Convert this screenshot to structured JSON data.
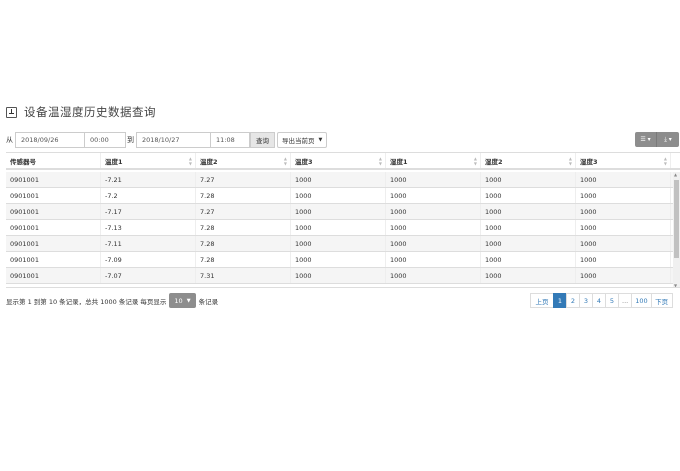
{
  "title": "设备温湿度历史数据查询",
  "filter": {
    "from_label": "从",
    "from_date": "2018/09/26",
    "from_time": "00:00",
    "to_label": "到",
    "to_date": "2018/10/27",
    "to_time": "11:08",
    "query_button": "查询",
    "export_select": "导出当前页"
  },
  "toolbar": {
    "columns_icon": "list-icon",
    "export_icon": "download-icon"
  },
  "table": {
    "headers": [
      "传感器号",
      "温度1",
      "温度2",
      "温度3",
      "湿度1",
      "湿度2",
      "湿度3"
    ],
    "rows": [
      [
        "0901001",
        "-7.21",
        "7.27",
        "1000",
        "1000",
        "1000",
        "1000"
      ],
      [
        "0901001",
        "-7.2",
        "7.28",
        "1000",
        "1000",
        "1000",
        "1000"
      ],
      [
        "0901001",
        "-7.17",
        "7.27",
        "1000",
        "1000",
        "1000",
        "1000"
      ],
      [
        "0901001",
        "-7.13",
        "7.28",
        "1000",
        "1000",
        "1000",
        "1000"
      ],
      [
        "0901001",
        "-7.11",
        "7.28",
        "1000",
        "1000",
        "1000",
        "1000"
      ],
      [
        "0901001",
        "-7.09",
        "7.28",
        "1000",
        "1000",
        "1000",
        "1000"
      ],
      [
        "0901001",
        "-7.07",
        "7.31",
        "1000",
        "1000",
        "1000",
        "1000"
      ]
    ]
  },
  "footer": {
    "info_prefix": "显示第 1 到第 10 条记录，总共 1000 条记录 每页显示",
    "page_size": "10",
    "info_suffix": "条记录"
  },
  "pagination": {
    "prev": "上页",
    "pages": [
      "1",
      "2",
      "3",
      "4",
      "5",
      "...",
      "100"
    ],
    "active": "1",
    "next": "下页"
  },
  "colors": {
    "accent": "#337ab7",
    "button_gray": "#8d8d8d",
    "stripe": "#f5f5f5"
  }
}
